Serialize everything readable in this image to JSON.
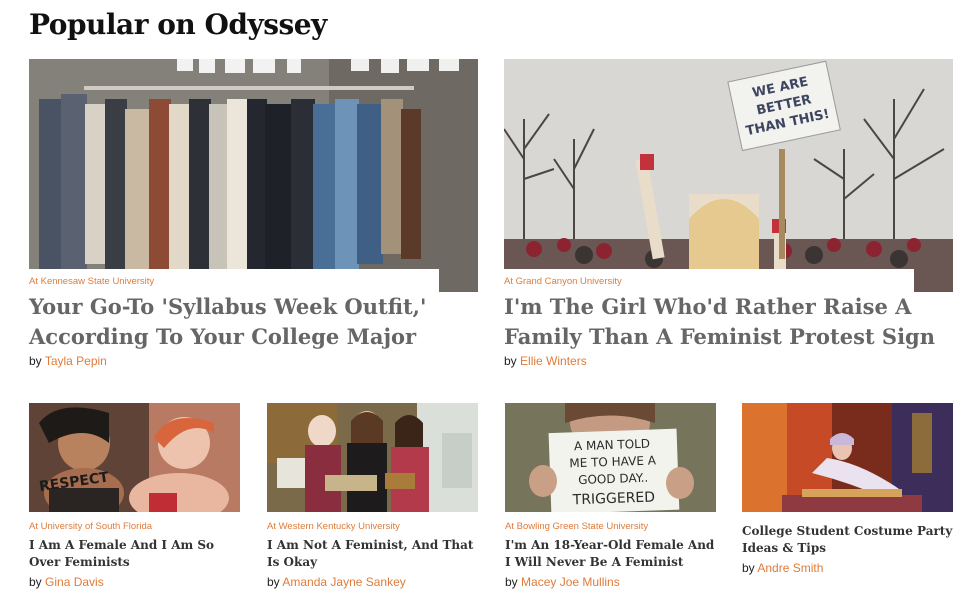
{
  "section": {
    "title": "Popular on Odyssey"
  },
  "featured": [
    {
      "university": "At Kennesaw State University",
      "headline_line1": "Your Go-To 'Syllabus Week Outfit,'",
      "headline_line2": "According To Your College Major",
      "by": "by",
      "author": "Tayla Pepin",
      "image_icon": "clothes-rack-photo"
    },
    {
      "university": "At Grand Canyon University",
      "headline_line1": "I'm The Girl Who'd Rather Raise A",
      "headline_line2": "Family Than A Feminist Protest Sign",
      "by": "by",
      "author": "Ellie Winters",
      "image_icon": "protest-crowd-photo",
      "sign_line1": "WE ARE",
      "sign_line2": "BETTER",
      "sign_line3": "THAN THIS!"
    }
  ],
  "small": [
    {
      "university": "At University of South Florida",
      "headline": "I Am A Female And I Am So Over Feminists",
      "by": "by",
      "author": "Gina Davis",
      "image_icon": "women-body-paint-photo",
      "paint_text": "RESPECT"
    },
    {
      "university": "At Western Kentucky University",
      "headline": "I Am Not A Feminist, And That Is Okay",
      "by": "by",
      "author": "Amanda Jayne Sankey",
      "image_icon": "women-baking-photo"
    },
    {
      "university": "At Bowling Green State University",
      "headline": "I'm An 18-Year-Old Female And I Will Never Be A Feminist",
      "by": "by",
      "author": "Macey Joe Mullins",
      "image_icon": "sign-holding-photo",
      "sign_line1": "A MAN TOLD",
      "sign_line2": "ME TO HAVE A",
      "sign_line3": "GOOD DAY..",
      "sign_line4": "TRIGGERED"
    },
    {
      "university": "",
      "headline": "College Student Costume Party Ideas & Tips",
      "by": "by",
      "author": "Andre Smith",
      "image_icon": "costume-party-photo"
    }
  ],
  "colors": {
    "accent": "#e07b39",
    "headline_big": "#666666",
    "headline_small": "#333333"
  }
}
